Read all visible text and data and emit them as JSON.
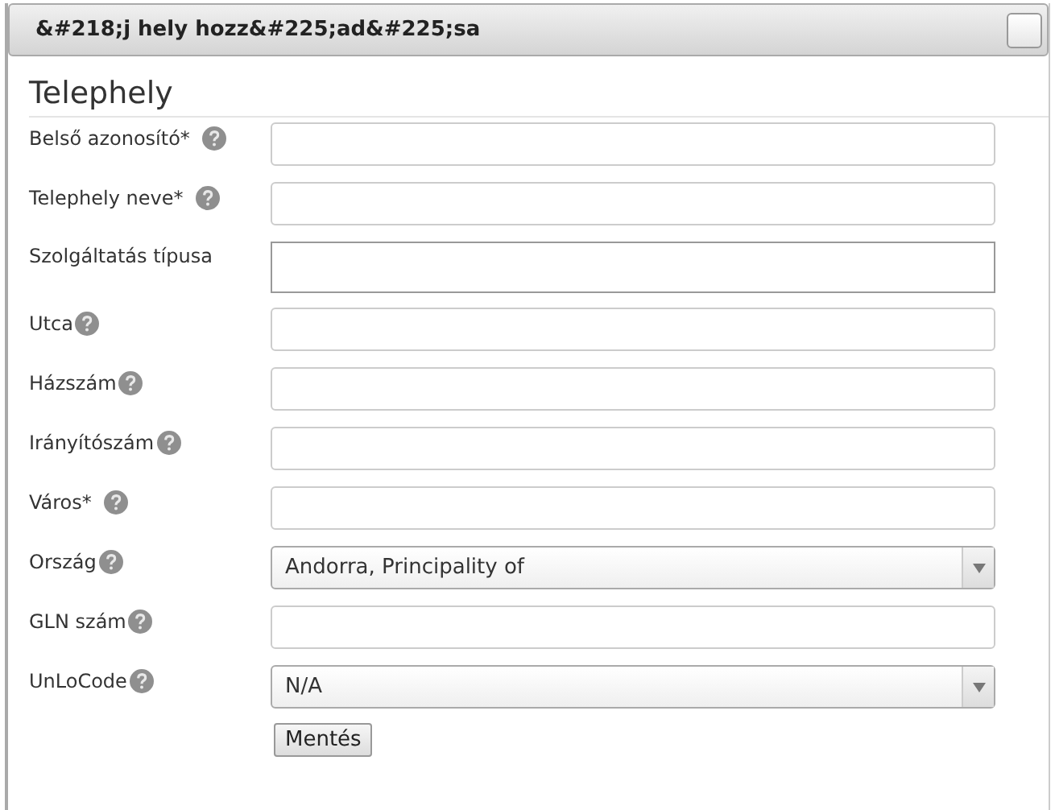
{
  "window": {
    "title": "&#218;j hely hozz&#225;ad&#225;sa"
  },
  "section": {
    "title": "Telephely"
  },
  "fields": [
    {
      "label": "Belső azonosító*",
      "help": true,
      "kind": "text"
    },
    {
      "label": "Telephely neve*",
      "help": true,
      "kind": "text"
    },
    {
      "label": "Szolgáltatás típusa",
      "help": false,
      "kind": "textarea"
    },
    {
      "label": "Utca",
      "help": true,
      "kind": "text"
    },
    {
      "label": "Házszám",
      "help": true,
      "kind": "text"
    },
    {
      "label": "Irányítószám",
      "help": true,
      "kind": "text"
    },
    {
      "label": "Város*",
      "help": true,
      "kind": "text"
    },
    {
      "label": "Ország",
      "help": true,
      "kind": "select",
      "value": "Andorra, Principality of"
    },
    {
      "label": "GLN szám",
      "help": true,
      "kind": "text"
    },
    {
      "label": "UnLoCode",
      "help": true,
      "kind": "select",
      "value": "N/A"
    }
  ],
  "buttons": [
    "Mentés"
  ]
}
